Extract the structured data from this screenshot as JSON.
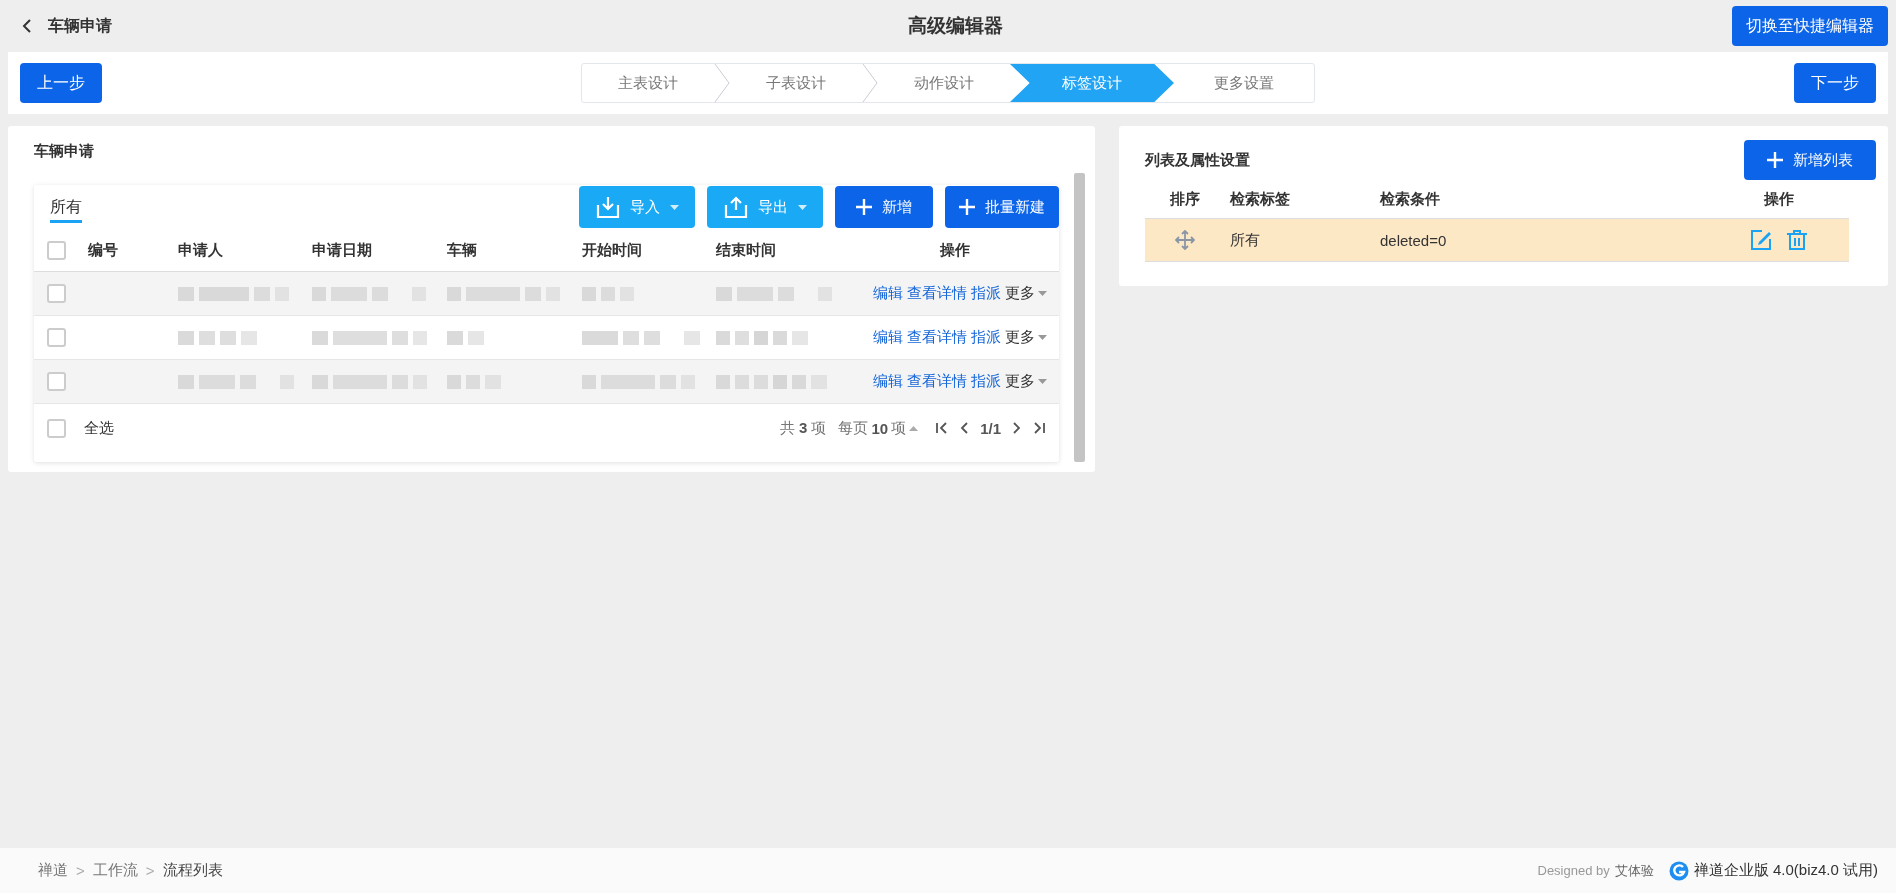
{
  "header": {
    "back_label": "车辆申请",
    "title": "高级编辑器",
    "switch_button": "切换至快捷编辑器"
  },
  "stepbar": {
    "prev_button": "上一步",
    "next_button": "下一步",
    "steps": [
      {
        "label": "主表设计",
        "selected": false
      },
      {
        "label": "子表设计",
        "selected": false
      },
      {
        "label": "动作设计",
        "selected": false
      },
      {
        "label": "标签设计",
        "selected": true
      },
      {
        "label": "更多设置",
        "selected": false
      }
    ]
  },
  "left_panel": {
    "title": "车辆申请",
    "tabs": [
      {
        "label": "所有",
        "selected": true
      }
    ],
    "buttons": [
      {
        "label": "导入",
        "kind": "import"
      },
      {
        "label": "导出",
        "kind": "export"
      },
      {
        "label": "新增",
        "kind": "add"
      },
      {
        "label": "批量新建",
        "kind": "add"
      }
    ],
    "table": {
      "columns": [
        "编号",
        "申请人",
        "申请日期",
        "车辆",
        "开始时间",
        "结束时间",
        "操作"
      ],
      "header_checked": false,
      "rows": [
        {
          "checked": false,
          "actions": [
            "编辑",
            "查看详情",
            "指派"
          ],
          "more": "更多"
        },
        {
          "checked": false,
          "actions": [
            "编辑",
            "查看详情",
            "指派"
          ],
          "more": "更多"
        },
        {
          "checked": false,
          "actions": [
            "编辑",
            "查看详情",
            "指派"
          ],
          "more": "更多"
        }
      ]
    },
    "footer": {
      "select_all_checked": false,
      "select_all": "全选",
      "total_prefix": "共",
      "total": "3",
      "total_suffix": "项",
      "per_page_prefix": "每页",
      "per_page": "10",
      "per_page_suffix": "项",
      "page": "1/1"
    }
  },
  "right_panel": {
    "title": "列表及属性设置",
    "add_button": "新增列表",
    "columns": [
      "排序",
      "检索标签",
      "检索条件",
      "操作"
    ],
    "rows": [
      {
        "label": "所有",
        "condition": "deleted=0",
        "selected": true
      }
    ]
  },
  "status_bar": {
    "breadcrumb": [
      {
        "label": "禅道",
        "separator": ">"
      },
      {
        "label": "工作流",
        "separator": ">"
      },
      {
        "label": "流程列表"
      }
    ],
    "designed_by": "Designed by",
    "designer": "艾体验",
    "product": "禅道企业版 4.0(biz4.0 试用)"
  }
}
